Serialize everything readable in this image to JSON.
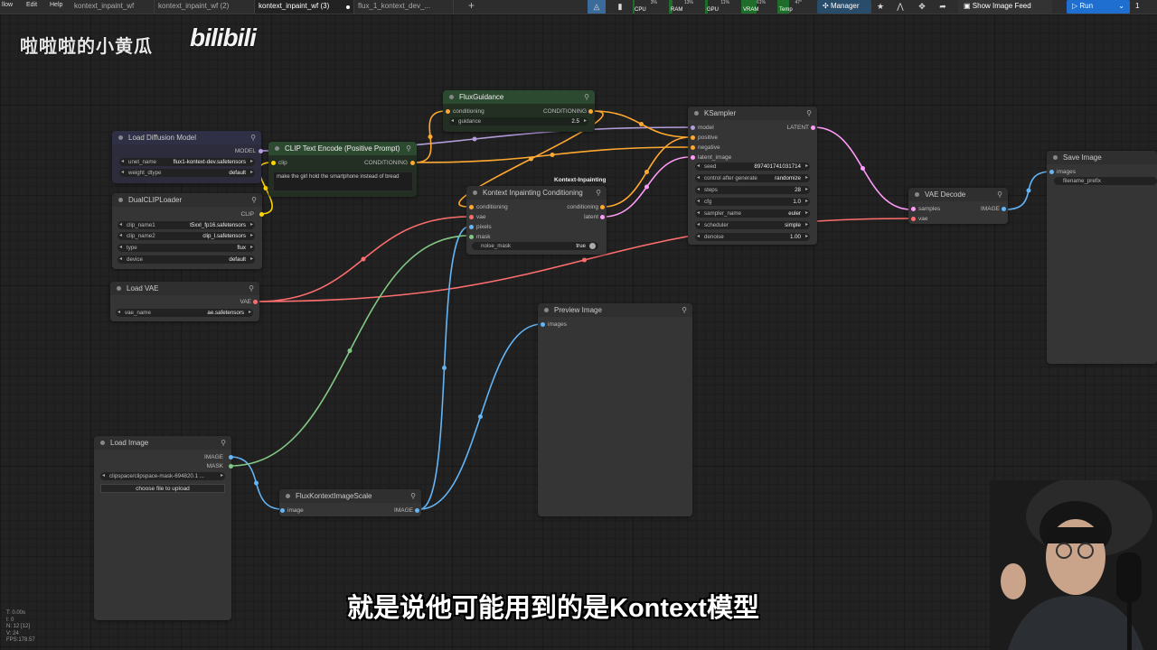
{
  "menu": {
    "workflow": "llow",
    "edit": "Edit",
    "help": "Help"
  },
  "tabs": [
    {
      "label": "kontext_inpaint_wf",
      "active": false
    },
    {
      "label": "kontext_inpaint_wf (2)",
      "active": false
    },
    {
      "label": "kontext_inpaint_wf (3)",
      "active": true
    },
    {
      "label": "flux_1_kontext_dev_...",
      "active": false
    }
  ],
  "monitors": [
    {
      "label": "CPU",
      "value": "3%",
      "fill": 0.03
    },
    {
      "label": "RAM",
      "value": "13%",
      "fill": 0.13
    },
    {
      "label": "GPU",
      "value": "11%",
      "fill": 0.11
    },
    {
      "label": "VRAM",
      "value": "61%",
      "fill": 0.61
    },
    {
      "label": "Temp",
      "value": "47°",
      "fill": 0.47
    }
  ],
  "toolbar": {
    "manager": "Manager",
    "show_image_feed": "Show Image Feed",
    "run": "Run",
    "queue_count": "1"
  },
  "nodes": {
    "load_diffusion": {
      "title": "Load Diffusion Model",
      "out_model": "MODEL",
      "unet_label": "unet_name",
      "unet_value": "flux1-kontext-dev.safetensors",
      "dtype_label": "weight_dtype",
      "dtype_value": "default"
    },
    "dual_clip": {
      "title": "DualCLIPLoader",
      "out_clip": "CLIP",
      "clip1_label": "clip_name1",
      "clip1_value": "t5xxl_fp16.safetensors",
      "clip2_label": "clip_name2",
      "clip2_value": "clip_l.safetensors",
      "type_label": "type",
      "type_value": "flux",
      "device_label": "device",
      "device_value": "default"
    },
    "load_vae": {
      "title": "Load VAE",
      "out_vae": "VAE",
      "vae_label": "vae_name",
      "vae_value": "ae.safetensors"
    },
    "clip_text": {
      "title": "CLIP Text Encode (Positive Prompt)",
      "in_clip": "clip",
      "out_cond": "CONDITIONING",
      "text": "make the girl hold the smartphone instead of bread"
    },
    "flux_guidance": {
      "title": "FluxGuidance",
      "in_cond": "conditioning",
      "out_cond": "CONDITIONING",
      "guidance_label": "guidance",
      "guidance_value": "2.5"
    },
    "kontext_inpaint": {
      "group": "Kontext-Inpainting",
      "title": "Kontext Inpainting Conditioning",
      "in_cond": "conditioning",
      "in_vae": "vae",
      "in_pixels": "pixels",
      "in_mask": "mask",
      "out_cond": "conditioning",
      "out_latent": "latent",
      "noise_label": "noise_mask",
      "noise_value": "true"
    },
    "ksampler": {
      "title": "KSampler",
      "in_model": "model",
      "in_pos": "positive",
      "in_neg": "negative",
      "in_latent": "latent_image",
      "out_latent": "LATENT",
      "seed_label": "seed",
      "seed_value": "897401741031714",
      "control_label": "control after generate",
      "control_value": "randomize",
      "steps_label": "steps",
      "steps_value": "28",
      "cfg_label": "cfg",
      "cfg_value": "1.0",
      "sampler_label": "sampler_name",
      "sampler_value": "euler",
      "scheduler_label": "scheduler",
      "scheduler_value": "simple",
      "denoise_label": "denoise",
      "denoise_value": "1.00"
    },
    "vae_decode": {
      "title": "VAE Decode",
      "in_samples": "samples",
      "in_vae": "vae",
      "out_image": "IMAGE"
    },
    "save_image": {
      "title": "Save Image",
      "in_images": "images",
      "prefix_label": "filename_prefix"
    },
    "preview_image": {
      "title": "Preview Image",
      "in_images": "images"
    },
    "load_image": {
      "title": "Load Image",
      "out_image": "IMAGE",
      "out_mask": "MASK",
      "file_value": "clipspace/clipspace-mask-694820.1 ...",
      "upload_label": "choose file to upload"
    },
    "flux_scale": {
      "title": "FluxKontextImageScale",
      "in_image": "image",
      "out_image": "IMAGE"
    }
  },
  "overlay": {
    "watermark_text": "啦啦啦的小黄瓜",
    "watermark_logo": "bilibili",
    "subtitle": "就是说他可能用到的是Kontext模型"
  },
  "stats": {
    "t": "T: 0.00s",
    "i": "I: 0",
    "n": "N: 12 [12]",
    "v": "V: 24",
    "fps": "FPS:178.57"
  },
  "colors": {
    "canvas_bg": "#222222",
    "wire_conditioning": "#ffa931",
    "wire_model": "#b39ddb",
    "wire_clip": "#ffd500",
    "wire_vae": "#ff6e6e",
    "wire_image": "#64b5f6",
    "wire_mask": "#81c784",
    "wire_latent": "#ff9cf9",
    "run_button": "#1f6fd1"
  }
}
